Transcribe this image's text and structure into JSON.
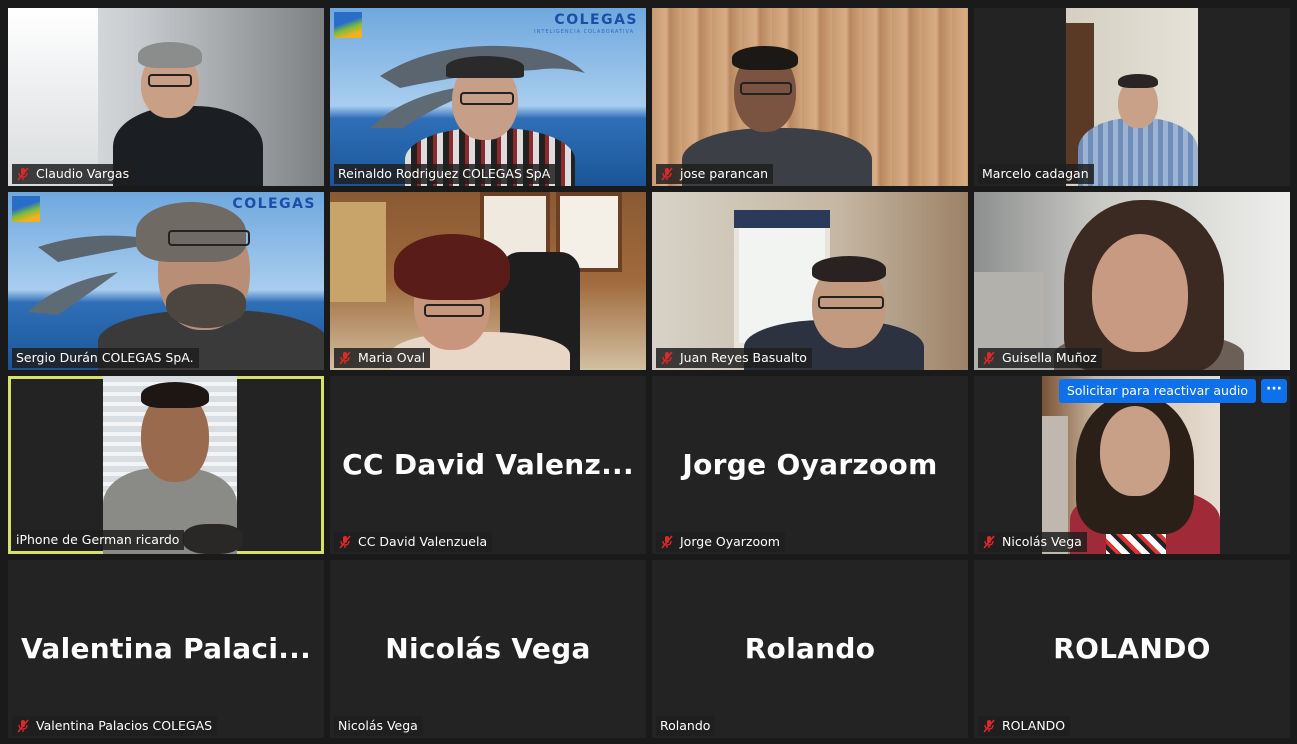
{
  "participants": [
    {
      "name": "Claudio Vargas",
      "muted": true
    },
    {
      "name": "Reinaldo Rodriguez  COLEGAS SpA",
      "muted": false
    },
    {
      "name": "jose parancan",
      "muted": true
    },
    {
      "name": "Marcelo cadagan",
      "muted": false
    },
    {
      "name": "Sergio Durán COLEGAS SpA.",
      "muted": false
    },
    {
      "name": "Maria Oval",
      "muted": true
    },
    {
      "name": "Juan Reyes Basualto",
      "muted": true
    },
    {
      "name": "Guisella Muñoz",
      "muted": true
    },
    {
      "name": "iPhone de German ricardo",
      "muted": false,
      "active_speaker": true
    },
    {
      "name": "CC David Valenzuela",
      "muted": true,
      "display": "CC  David  Valenz..."
    },
    {
      "name": "Jorge Oyarzoom",
      "muted": true,
      "display": "Jorge Oyarzoom"
    },
    {
      "name": "Nicolás Vega",
      "muted": true
    },
    {
      "name": "Valentina Palacios COLEGAS",
      "muted": true,
      "display": "Valentina  Palaci..."
    },
    {
      "name": "Nicolás Vega",
      "muted": false,
      "display": "Nicolás Vega"
    },
    {
      "name": "Rolando",
      "muted": false,
      "display": "Rolando"
    },
    {
      "name": "ROLANDO",
      "muted": true,
      "display": "ROLANDO"
    }
  ],
  "background_logo": {
    "text": "COLEGAS",
    "subtitle": "INTELIGENCIA COLABORATIVA"
  },
  "request_unmute": {
    "label": "Solicitar para reactivar audio",
    "more": "···"
  },
  "colors": {
    "background": "#1a1a1a",
    "tile": "#232323",
    "active_border": "#d6e16a",
    "muted_icon": "#e02828",
    "button": "#0e71eb"
  },
  "icons": {
    "muted": "mic-muted-icon",
    "more": "more-options-icon"
  }
}
